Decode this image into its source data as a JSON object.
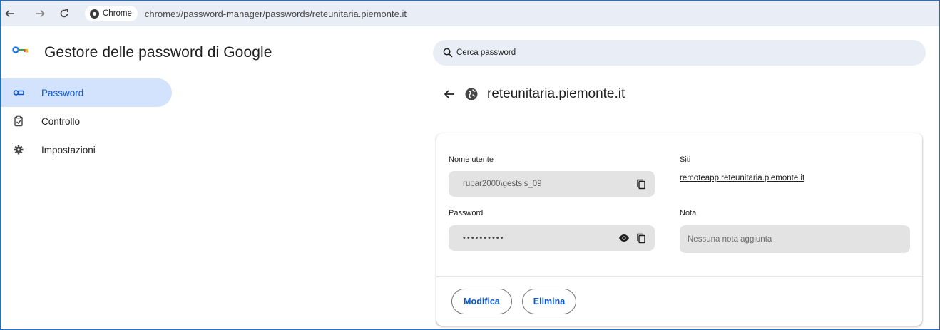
{
  "browser": {
    "chip_label": "Chrome",
    "url": "chrome://password-manager/passwords/reteunitaria.piemonte.it",
    "back_icon": "arrow-left",
    "forward_icon": "arrow-right",
    "reload_icon": "reload"
  },
  "header": {
    "title": "Gestore delle password di Google",
    "search_placeholder": "Cerca password"
  },
  "sidebar": {
    "items": [
      {
        "label": "Password",
        "icon": "key-icon",
        "active": true
      },
      {
        "label": "Controllo",
        "icon": "checkup-icon",
        "active": false
      },
      {
        "label": "Impostazioni",
        "icon": "gear-icon",
        "active": false
      }
    ]
  },
  "detail": {
    "site_title": "reteunitaria.piemonte.it",
    "username_label": "Nome utente",
    "username_value": "rupar2000\\gestsis_09",
    "password_label": "Password",
    "password_value": "••••••••••",
    "sites_label": "Siti",
    "site_link": "remoteapp.reteunitaria.piemonte.it",
    "note_label": "Nota",
    "note_placeholder": "Nessuna nota aggiunta",
    "edit_button": "Modifica",
    "delete_button": "Elimina"
  },
  "colors": {
    "accent": "#0b57d0",
    "active_bg": "#d3e3fd",
    "field_bg": "#e3e3e3",
    "toolbar_bg": "#e9eef6"
  }
}
